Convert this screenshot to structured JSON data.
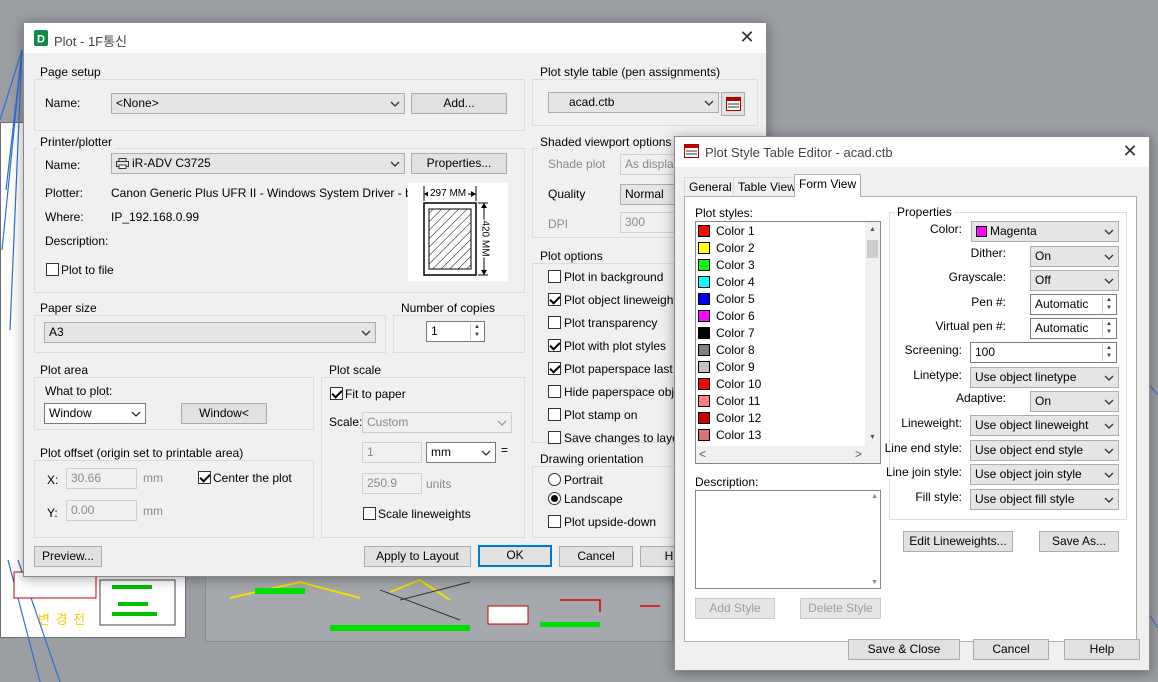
{
  "plot_dialog": {
    "title": "Plot - 1F통신",
    "page_setup": {
      "group": "Page setup",
      "name_label": "Name:",
      "name_value": "<None>",
      "add_button": "Add..."
    },
    "printer": {
      "group": "Printer/plotter",
      "name_label": "Name:",
      "name_value": "iR-ADV C3725",
      "properties_button": "Properties...",
      "plotter_label": "Plotter:",
      "plotter_value": "Canon Generic Plus UFR II - Windows System Driver - b...",
      "where_label": "Where:",
      "where_value": "IP_192.168.0.99",
      "description_label": "Description:",
      "plot_to_file": "Plot to file",
      "preview_width": "297 MM",
      "preview_height": "420 MM"
    },
    "paper_size": {
      "group": "Paper size",
      "value": "A3"
    },
    "copies": {
      "group": "Number of copies",
      "value": "1"
    },
    "plot_area": {
      "group": "Plot area",
      "what_label": "What to plot:",
      "what_value": "Window",
      "window_button": "Window<"
    },
    "plot_offset": {
      "group": "Plot offset (origin set to printable area)",
      "x_label": "X:",
      "x_value": "30.66",
      "x_unit": "mm",
      "y_label": "Y:",
      "y_value": "0.00",
      "y_unit": "mm",
      "center": "Center the plot"
    },
    "plot_scale": {
      "group": "Plot scale",
      "fit": "Fit to paper",
      "scale_label": "Scale:",
      "scale_value": "Custom",
      "num_value": "1",
      "unit_value": "mm",
      "equals": "=",
      "den_value": "250.9",
      "den_unit": "units",
      "scale_lw": "Scale lineweights"
    },
    "style_table": {
      "group": "Plot style table (pen assignments)",
      "value": "acad.ctb"
    },
    "shaded": {
      "group": "Shaded viewport options",
      "shade_label": "Shade plot",
      "shade_value": "As displayed",
      "quality_label": "Quality",
      "quality_value": "Normal",
      "dpi_label": "DPI",
      "dpi_value": "300"
    },
    "plot_options": {
      "group": "Plot options",
      "items": [
        {
          "label": "Plot in background",
          "checked": false
        },
        {
          "label": "Plot object lineweights",
          "checked": true
        },
        {
          "label": "Plot transparency",
          "checked": false
        },
        {
          "label": "Plot with plot styles",
          "checked": true
        },
        {
          "label": "Plot paperspace last",
          "checked": true
        },
        {
          "label": "Hide paperspace objects",
          "checked": false
        },
        {
          "label": "Plot stamp on",
          "checked": false
        },
        {
          "label": "Save changes to layout",
          "checked": false
        }
      ]
    },
    "orientation": {
      "group": "Drawing orientation",
      "portrait": "Portrait",
      "landscape": "Landscape",
      "upside_down": "Plot upside-down"
    },
    "buttons": {
      "preview": "Preview...",
      "apply": "Apply to Layout",
      "ok": "OK",
      "cancel": "Cancel",
      "help": "Help"
    }
  },
  "style_editor": {
    "title": "Plot Style Table Editor - acad.ctb",
    "tabs": [
      "General",
      "Table View",
      "Form View"
    ],
    "plot_styles_label": "Plot styles:",
    "styles": [
      {
        "name": "Color 1",
        "color": "#ff0000"
      },
      {
        "name": "Color 2",
        "color": "#ffff00"
      },
      {
        "name": "Color 3",
        "color": "#00ff00"
      },
      {
        "name": "Color 4",
        "color": "#00ffff"
      },
      {
        "name": "Color 5",
        "color": "#0000ff"
      },
      {
        "name": "Color 6",
        "color": "#ff00ff"
      },
      {
        "name": "Color 7",
        "color": "#000000"
      },
      {
        "name": "Color 8",
        "color": "#808080"
      },
      {
        "name": "Color 9",
        "color": "#c0c0c0"
      },
      {
        "name": "Color 10",
        "color": "#ff0000"
      },
      {
        "name": "Color 11",
        "color": "#ff7f7f"
      },
      {
        "name": "Color 12",
        "color": "#cc0000"
      },
      {
        "name": "Color 13",
        "color": "#e07070"
      }
    ],
    "description_label": "Description:",
    "add_style": "Add Style",
    "delete_style": "Delete Style",
    "properties": {
      "group": "Properties",
      "color_label": "Color:",
      "color_value": "Magenta",
      "color_swatch": "#ff00ff",
      "dither_label": "Dither:",
      "dither_value": "On",
      "grayscale_label": "Grayscale:",
      "grayscale_value": "Off",
      "pen_label": "Pen #:",
      "pen_value": "Automatic",
      "vpen_label": "Virtual pen #:",
      "vpen_value": "Automatic",
      "screening_label": "Screening:",
      "screening_value": "100",
      "linetype_label": "Linetype:",
      "linetype_value": "Use object linetype",
      "adaptive_label": "Adaptive:",
      "adaptive_value": "On",
      "lineweight_label": "Lineweight:",
      "lineweight_value": "Use object lineweight",
      "lineend_label": "Line end style:",
      "lineend_value": "Use object end style",
      "linejoin_label": "Line join style:",
      "linejoin_value": "Use object join style",
      "fill_label": "Fill style:",
      "fill_value": "Use object fill style"
    },
    "edit_lineweights": "Edit Lineweights...",
    "save_as": "Save As...",
    "save_close": "Save & Close",
    "cancel": "Cancel",
    "help": "Help"
  },
  "cad": {
    "stamp_text": "변 경 전"
  }
}
